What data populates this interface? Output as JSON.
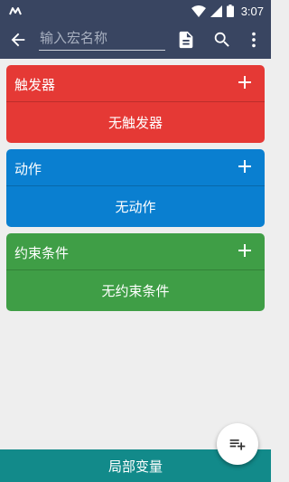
{
  "status_bar": {
    "time": "3:07",
    "icons": [
      "app-notification-icon",
      "wifi-icon",
      "cellular-signal-icon",
      "battery-icon"
    ]
  },
  "toolbar": {
    "name_placeholder": "输入宏名称",
    "name_value": "",
    "icons": [
      "back-arrow-icon",
      "document-icon",
      "search-icon",
      "more-vert-icon"
    ]
  },
  "sections": {
    "triggers": {
      "title": "触发器",
      "empty_text": "无触发器",
      "color": "#e53935"
    },
    "actions": {
      "title": "动作",
      "empty_text": "无动作",
      "color": "#0a7fd0"
    },
    "constraints": {
      "title": "约束条件",
      "empty_text": "无约束条件",
      "color": "#3f9e46"
    }
  },
  "bottom_bar": {
    "label": "局部变量",
    "color": "#128a8a"
  },
  "fab": {
    "icon": "playlist-add-icon"
  },
  "colors": {
    "toolbar": "#394561",
    "background": "#eeeeee"
  }
}
